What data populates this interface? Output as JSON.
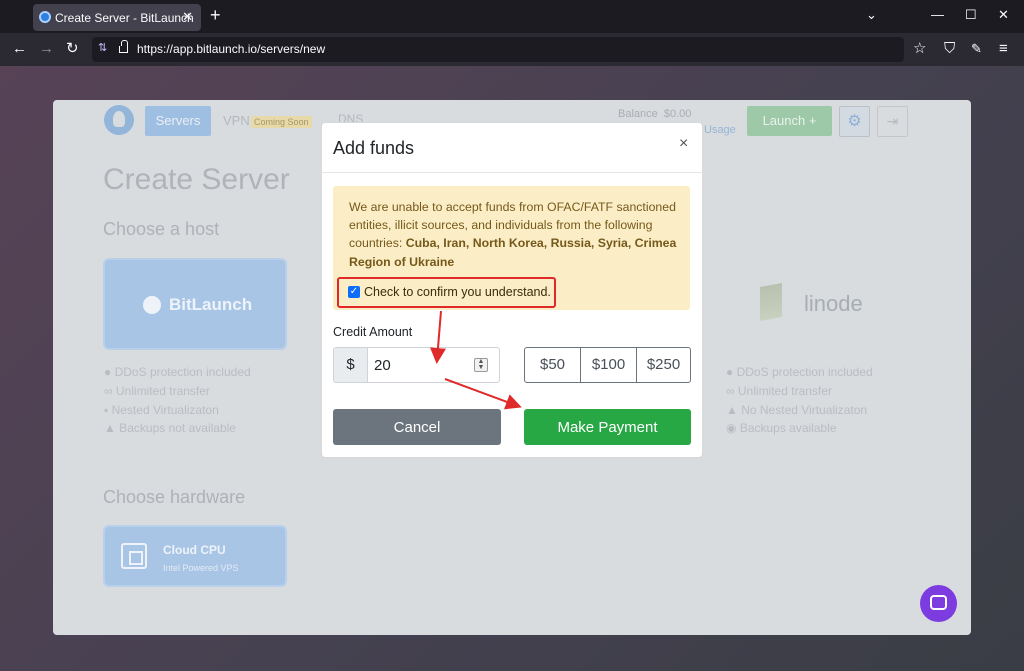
{
  "browser": {
    "tab_title": "Create Server - BitLaunch",
    "new_tab": "+",
    "tab_close": "✕",
    "url": "https://app.bitlaunch.io/servers/new",
    "window_controls": [
      "⌄",
      "—",
      "☐",
      "✕"
    ],
    "nav": {
      "back": "←",
      "forward": "→",
      "reload": "↻",
      "star": "☆",
      "shield": "⛉",
      "menu": "≡"
    }
  },
  "app": {
    "nav": {
      "servers": "Servers",
      "vpn": "VPN",
      "coming_soon": "Coming Soon",
      "dns": "DNS"
    },
    "balance_label": "Balance",
    "balance_value": "$0.00",
    "usage": "Usage",
    "launch": "Launch",
    "launch_icon": "+",
    "page_title": "Create Server",
    "choose_host": "Choose a host",
    "hosts": [
      {
        "name": "BitLaunch",
        "features": [
          "DDoS protection included",
          "Unlimited transfer",
          "Nested Virtualizaton",
          "Backups not available"
        ]
      },
      {
        "name": "linode",
        "features": [
          "DDoS protection included",
          "Unlimited transfer",
          "No Nested Virtualizaton",
          "Backups available"
        ]
      }
    ],
    "choose_hardware": "Choose hardware",
    "hardware": {
      "name": "Cloud CPU",
      "sub": "Intel Powered VPS"
    }
  },
  "modal": {
    "title": "Add funds",
    "close": "×",
    "warning_text": "We are unable to accept funds from OFAC/FATF sanctioned entities, illicit sources, and individuals from the following countries: ",
    "warning_countries": "Cuba, Iran, North Korea, Russia, Syria, Crimea Region of Ukraine",
    "confirm_label": "Check to confirm you understand.",
    "confirm_checked": true,
    "credit_label": "Credit Amount",
    "currency": "$",
    "amount": "20",
    "presets": [
      "$50",
      "$100",
      "$250"
    ],
    "cancel": "Cancel",
    "pay": "Make Payment"
  },
  "colors": {
    "pay_green": "#28a745",
    "cancel_gray": "#6c757d",
    "warning_bg": "#fbeec6",
    "annotation_red": "#e02a2a",
    "chat_purple": "#7d3ce0"
  }
}
